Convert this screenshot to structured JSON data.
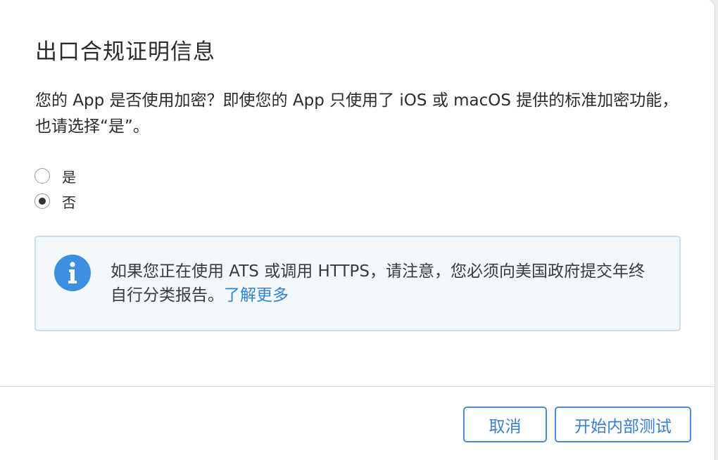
{
  "dialog": {
    "title": "出口合规证明信息",
    "question": "您的 App 是否使用加密？即使您的 App 只使用了 iOS 或 macOS 提供的标准加密功能，也请选择“是”。"
  },
  "options": [
    {
      "label": "是",
      "checked": false
    },
    {
      "label": "否",
      "checked": true
    }
  ],
  "notice": {
    "icon": "info-icon",
    "text": "如果您正在使用 ATS 或调用 HTTPS，请注意，您必须向美国政府提交年终自行分类报告。",
    "link_label": "了解更多",
    "accent_color": "#3d8fe0"
  },
  "footer": {
    "cancel_label": "取消",
    "start_label": "开始内部测试"
  }
}
